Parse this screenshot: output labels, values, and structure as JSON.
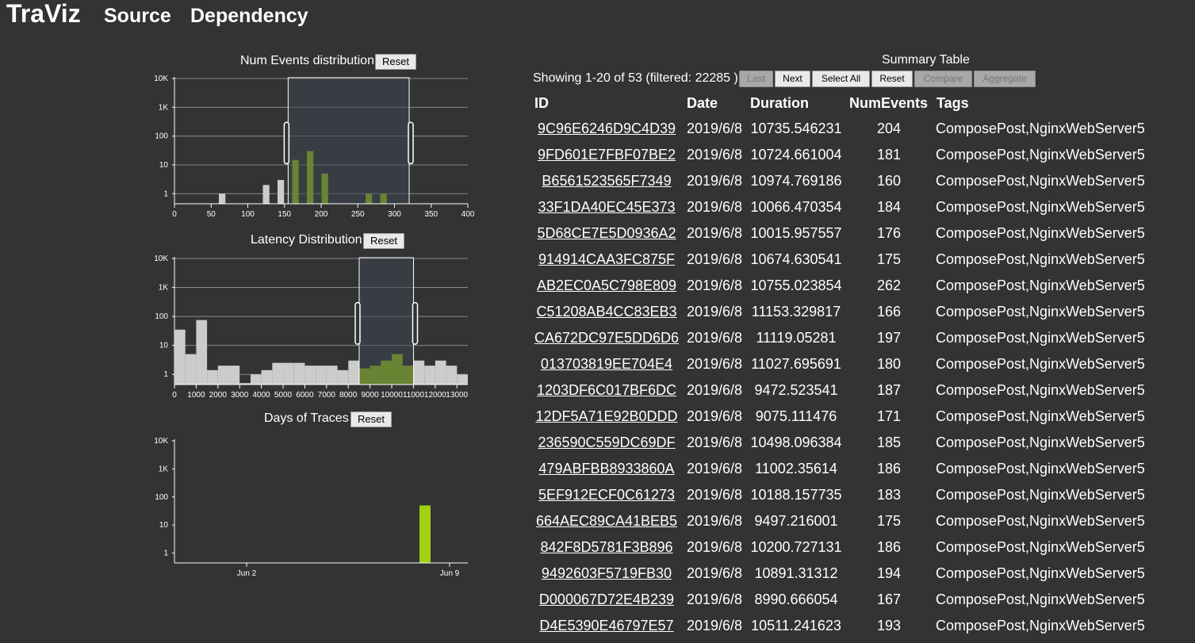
{
  "header": {
    "brand": "TraViz",
    "nav": [
      "Source",
      "Dependency"
    ]
  },
  "colors": {
    "background": "#333333",
    "selected_bar": "#a3d011",
    "unselected_bar": "#cccccc",
    "brush_fill": "#3b4650"
  },
  "charts": {
    "num_events": {
      "title": "Num Events distribution",
      "reset_label": "Reset"
    },
    "latency": {
      "title": "Latency Distribution",
      "reset_label": "Reset"
    },
    "days": {
      "title": "Days of Traces",
      "reset_label": "Reset"
    }
  },
  "chart_data": [
    {
      "type": "bar",
      "title": "Num Events distribution",
      "yscale": "log",
      "yticks": [
        "1",
        "10",
        "100",
        "1K",
        "10K"
      ],
      "xticks": [
        "0",
        "50",
        "100",
        "150",
        "200",
        "250",
        "300",
        "350",
        "400"
      ],
      "xlim": [
        0,
        400
      ],
      "bin_width": 10,
      "brush": [
        155,
        320
      ],
      "bars": [
        {
          "x": 60,
          "value": 1
        },
        {
          "x": 120,
          "value": 2
        },
        {
          "x": 140,
          "value": 3
        },
        {
          "x": 160,
          "value": 15
        },
        {
          "x": 180,
          "value": 30
        },
        {
          "x": 200,
          "value": 5
        },
        {
          "x": 260,
          "value": 1
        },
        {
          "x": 280,
          "value": 1
        }
      ]
    },
    {
      "type": "bar",
      "title": "Latency Distribution",
      "yscale": "log",
      "yticks": [
        "1",
        "10",
        "100",
        "1K",
        "10K"
      ],
      "xticks": [
        "0",
        "1000",
        "2000",
        "3000",
        "4000",
        "5000",
        "6000",
        "7000",
        "8000",
        "9000",
        "10000",
        "11000",
        "12000",
        "13000"
      ],
      "xlim": [
        0,
        13500
      ],
      "bin_width": 500,
      "brush": [
        8500,
        11000
      ],
      "bars": [
        {
          "x": 0,
          "value": 35
        },
        {
          "x": 500,
          "value": 5
        },
        {
          "x": 1000,
          "value": 75
        },
        {
          "x": 1500,
          "value": 1.4
        },
        {
          "x": 2000,
          "value": 2
        },
        {
          "x": 2500,
          "value": 2
        },
        {
          "x": 3000,
          "value": 0.5
        },
        {
          "x": 3500,
          "value": 1
        },
        {
          "x": 4000,
          "value": 1.4
        },
        {
          "x": 4500,
          "value": 2.5
        },
        {
          "x": 5000,
          "value": 2.5
        },
        {
          "x": 5500,
          "value": 2.5
        },
        {
          "x": 6000,
          "value": 2
        },
        {
          "x": 6500,
          "value": 2
        },
        {
          "x": 7000,
          "value": 2
        },
        {
          "x": 7500,
          "value": 1.4
        },
        {
          "x": 8000,
          "value": 3
        },
        {
          "x": 8500,
          "value": 1.6
        },
        {
          "x": 9000,
          "value": 2
        },
        {
          "x": 9500,
          "value": 3
        },
        {
          "x": 10000,
          "value": 5
        },
        {
          "x": 10500,
          "value": 2
        },
        {
          "x": 11000,
          "value": 3
        },
        {
          "x": 11500,
          "value": 2
        },
        {
          "x": 12000,
          "value": 3
        },
        {
          "x": 12500,
          "value": 2
        },
        {
          "x": 13000,
          "value": 1
        }
      ]
    },
    {
      "type": "bar",
      "title": "Days of Traces",
      "yscale": "log",
      "yticks": [
        "1",
        "10",
        "100",
        "1K",
        "10K"
      ],
      "xticks": [
        "Jun 2",
        "Jun 9"
      ],
      "bars": [
        {
          "x": "2019-06-08",
          "value": 50
        }
      ]
    }
  ],
  "summary": {
    "title": "Summary Table",
    "showing": "Showing 1-20 of 53 (filtered: 22285 )",
    "buttons": {
      "last": "Last",
      "next": "Next",
      "select_all": "Select All",
      "reset": "Reset",
      "compare": "Compare",
      "aggregate": "Aggregate"
    },
    "columns": {
      "id": "ID",
      "date": "Date",
      "duration": "Duration",
      "num_events": "NumEvents",
      "tags": "Tags"
    },
    "rows": [
      {
        "id": "9C96E6246D9C4D39",
        "date": "2019/6/8",
        "duration": "10735.546231",
        "num_events": "204",
        "tags": "ComposePost,NginxWebServer5"
      },
      {
        "id": "9FD601E7FBF07BE2",
        "date": "2019/6/8",
        "duration": "10724.661004",
        "num_events": "181",
        "tags": "ComposePost,NginxWebServer5"
      },
      {
        "id": "B6561523565F7349",
        "date": "2019/6/8",
        "duration": "10974.769186",
        "num_events": "160",
        "tags": "ComposePost,NginxWebServer5"
      },
      {
        "id": "33F1DA40EC45E373",
        "date": "2019/6/8",
        "duration": "10066.470354",
        "num_events": "184",
        "tags": "ComposePost,NginxWebServer5"
      },
      {
        "id": "5D68CE7E5D0936A2",
        "date": "2019/6/8",
        "duration": "10015.957557",
        "num_events": "176",
        "tags": "ComposePost,NginxWebServer5"
      },
      {
        "id": "914914CAA3FC875F",
        "date": "2019/6/8",
        "duration": "10674.630541",
        "num_events": "175",
        "tags": "ComposePost,NginxWebServer5"
      },
      {
        "id": "AB2EC0A5C798E809",
        "date": "2019/6/8",
        "duration": "10755.023854",
        "num_events": "262",
        "tags": "ComposePost,NginxWebServer5"
      },
      {
        "id": "C51208AB4CC83EB3",
        "date": "2019/6/8",
        "duration": "11153.329817",
        "num_events": "166",
        "tags": "ComposePost,NginxWebServer5"
      },
      {
        "id": "CA672DC97E5DD6D6",
        "date": "2019/6/8",
        "duration": "11119.05281",
        "num_events": "197",
        "tags": "ComposePost,NginxWebServer5"
      },
      {
        "id": "013703819EE704E4",
        "date": "2019/6/8",
        "duration": "11027.695691",
        "num_events": "180",
        "tags": "ComposePost,NginxWebServer5"
      },
      {
        "id": "1203DF6C017BF6DC",
        "date": "2019/6/8",
        "duration": "9472.523541",
        "num_events": "187",
        "tags": "ComposePost,NginxWebServer5"
      },
      {
        "id": "12DF5A71E92B0DDD",
        "date": "2019/6/8",
        "duration": "9075.111476",
        "num_events": "171",
        "tags": "ComposePost,NginxWebServer5"
      },
      {
        "id": "236590C559DC69DF",
        "date": "2019/6/8",
        "duration": "10498.096384",
        "num_events": "185",
        "tags": "ComposePost,NginxWebServer5"
      },
      {
        "id": "479ABFBB8933860A",
        "date": "2019/6/8",
        "duration": "11002.35614",
        "num_events": "186",
        "tags": "ComposePost,NginxWebServer5"
      },
      {
        "id": "5EF912ECF0C61273",
        "date": "2019/6/8",
        "duration": "10188.157735",
        "num_events": "183",
        "tags": "ComposePost,NginxWebServer5"
      },
      {
        "id": "664AEC89CA41BEB5",
        "date": "2019/6/8",
        "duration": "9497.216001",
        "num_events": "175",
        "tags": "ComposePost,NginxWebServer5"
      },
      {
        "id": "842F8D5781F3B896",
        "date": "2019/6/8",
        "duration": "10200.727131",
        "num_events": "186",
        "tags": "ComposePost,NginxWebServer5"
      },
      {
        "id": "9492603F5719FB30",
        "date": "2019/6/8",
        "duration": "10891.31312",
        "num_events": "194",
        "tags": "ComposePost,NginxWebServer5"
      },
      {
        "id": "D000067D72E4B239",
        "date": "2019/6/8",
        "duration": "8990.666054",
        "num_events": "167",
        "tags": "ComposePost,NginxWebServer5"
      },
      {
        "id": "D4E5390E46797E57",
        "date": "2019/6/8",
        "duration": "10511.241623",
        "num_events": "193",
        "tags": "ComposePost,NginxWebServer5"
      }
    ]
  }
}
